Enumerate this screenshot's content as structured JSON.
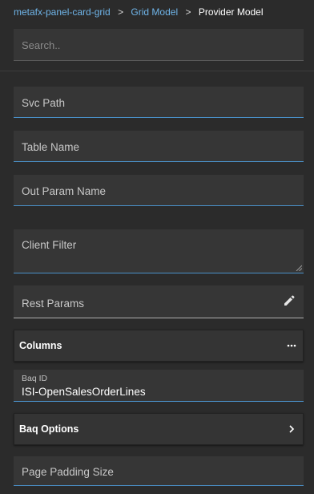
{
  "breadcrumb": {
    "items": [
      "metafx-panel-card-grid",
      "Grid Model"
    ],
    "separator": ">",
    "current": "Provider Model"
  },
  "search": {
    "placeholder": "Search.."
  },
  "fields": {
    "svc_path": "Svc Path",
    "table_name": "Table Name",
    "out_param_name": "Out Param Name",
    "client_filter": "Client Filter",
    "rest_params": "Rest Params",
    "columns": "Columns",
    "baq_id_label": "Baq ID",
    "baq_id_value": "ISI-OpenSalesOrderLines",
    "baq_options": "Baq Options",
    "page_padding_size": "Page Padding Size"
  },
  "icons": {
    "edit": "pencil-icon",
    "more": "more-horizontal-icon",
    "chevron": "chevron-right-icon"
  },
  "colors": {
    "background": "#2b2b2b",
    "field_background": "#363636",
    "accent": "#4a90c8",
    "link": "#6fb4e8"
  }
}
